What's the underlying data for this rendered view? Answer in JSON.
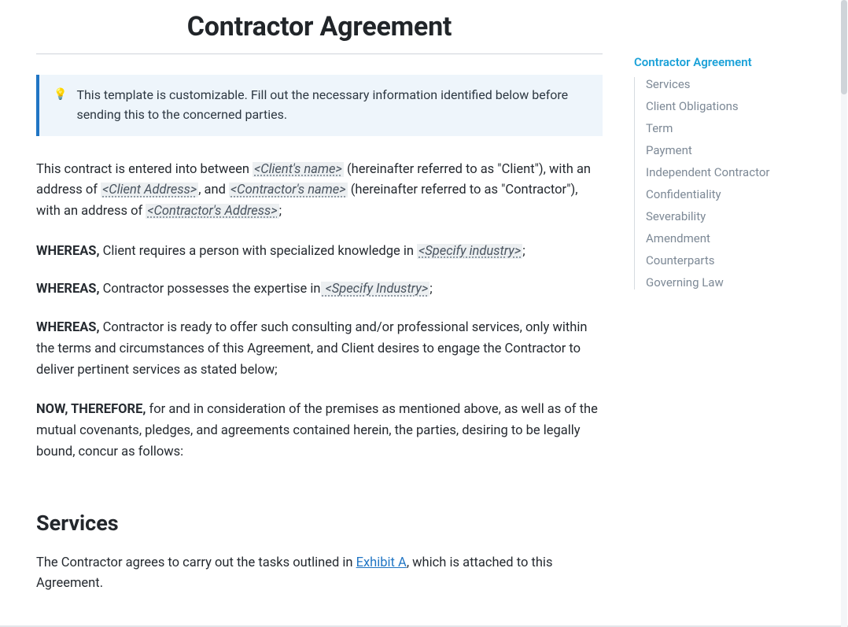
{
  "title": "Contractor Agreement",
  "callout": {
    "icon": "💡",
    "text": "This template is customizable. Fill out the necessary information identified below before sending this to the concerned parties."
  },
  "intro": {
    "p1_a": "This contract is entered into between ",
    "ph_client_name": "<Client's name>",
    "p1_b": " (hereinafter referred to as \"Client\"), with an address of ",
    "ph_client_addr": "<Client Address>",
    "p1_c": ", and ",
    "ph_contractor_name": "<Contractor's name>",
    "p1_d": " (hereinafter referred to as \"Contractor\"), with an address of ",
    "ph_contractor_addr": "<Contractor's Address>",
    "p1_e": ";"
  },
  "whereas1": {
    "lead": "WHEREAS,",
    "a": " Client requires a person with specialized knowledge in ",
    "ph": "<Specify industry>",
    "b": ";"
  },
  "whereas2": {
    "lead": "WHEREAS,",
    "a": " Contractor possesses the expertise in",
    "ph": " <Specify Industry>",
    "b": ";"
  },
  "whereas3": {
    "lead": "WHEREAS,",
    "a": " Contractor is ready to offer such consulting and/or professional services, only within the terms and circumstances of this Agreement, and Client desires to engage the Contractor to deliver pertinent services as stated below;"
  },
  "now": {
    "lead": "NOW, THEREFORE,",
    "a": " for and in consideration of the premises as mentioned above, as well as of the mutual covenants, pledges, and agreements contained herein, the parties, desiring to be legally bound, concur as follows:"
  },
  "section_services": {
    "heading": "Services",
    "p_a": "The Contractor agrees to carry out the tasks outlined in ",
    "link": "Exhibit A",
    "p_b": ", which is attached to this Agreement."
  },
  "toc": {
    "title": "Contractor Agreement",
    "items": [
      "Services",
      "Client Obligations",
      "Term",
      "Payment",
      "Independent Contractor",
      "Confidentiality",
      "Severability",
      "Amendment",
      "Counterparts",
      "Governing Law"
    ]
  }
}
